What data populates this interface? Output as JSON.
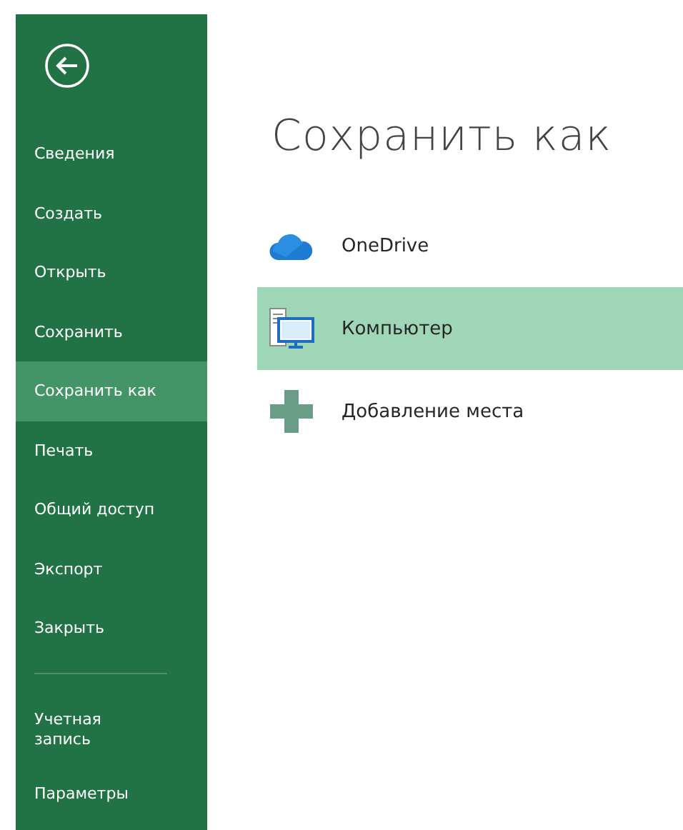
{
  "sidebar": {
    "items": [
      {
        "label": "Сведения",
        "selected": false
      },
      {
        "label": "Создать",
        "selected": false
      },
      {
        "label": "Открыть",
        "selected": false
      },
      {
        "label": "Сохранить",
        "selected": false
      },
      {
        "label": "Сохранить как",
        "selected": true
      },
      {
        "label": "Печать",
        "selected": false
      },
      {
        "label": "Общий доступ",
        "selected": false
      },
      {
        "label": "Экспорт",
        "selected": false
      },
      {
        "label": "Закрыть",
        "selected": false
      }
    ],
    "footer_items": [
      {
        "label": "Учетная запись",
        "selected": false
      },
      {
        "label": "Параметры",
        "selected": false
      }
    ]
  },
  "main": {
    "title": "Сохранить как",
    "places": [
      {
        "label": "OneDrive",
        "kind": "cloud",
        "selected": false
      },
      {
        "label": "Компьютер",
        "kind": "computer",
        "selected": true
      },
      {
        "label": "Добавление места",
        "kind": "add",
        "selected": false
      }
    ]
  }
}
